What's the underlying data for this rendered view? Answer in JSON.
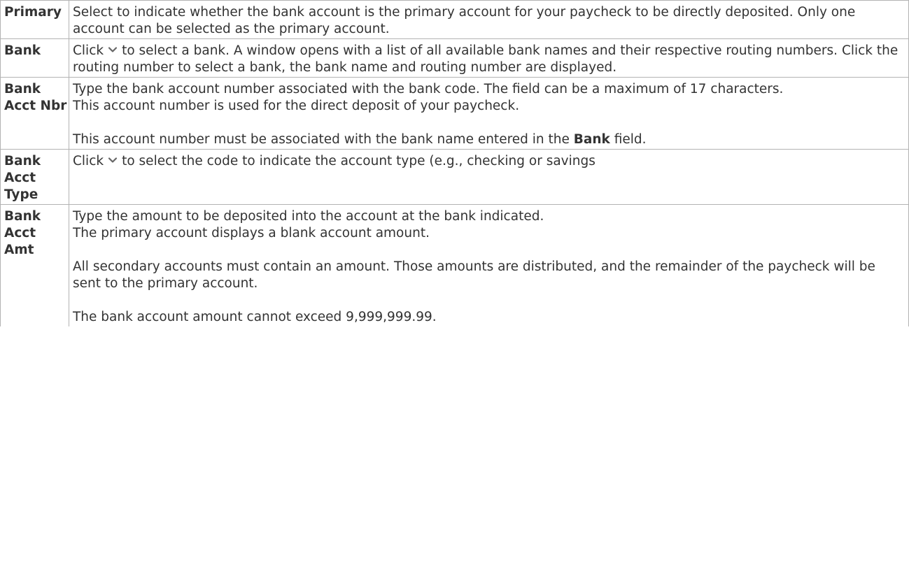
{
  "rows": [
    {
      "field": "Primary",
      "desc": [
        "Select to indicate whether the bank account is the primary account for your paycheck to be directly deposited. Only one account can be selected as the primary account."
      ]
    },
    {
      "field": "Bank",
      "desc_before_icon": "Click",
      "desc_after_icon": "to select a bank. A window opens with a list of all available bank names and their respective routing numbers. Click the routing number to select a bank, the bank name and routing number are displayed."
    },
    {
      "field": "Bank Acct Nbr",
      "desc": [
        "Type the bank account number associated with the bank code. The field can be a maximum of 17 characters.",
        "This account number is used for the direct deposit of your paycheck."
      ],
      "desc_gap_before": "This account number must be associated with the bank name entered in the",
      "desc_gap_bold": "Bank",
      "desc_gap_after": "field."
    },
    {
      "field": "Bank Acct Type",
      "desc_before_icon": "Click",
      "desc_after_icon": "to select the code to indicate the account type (e.g., checking or savings"
    },
    {
      "field": "Bank Acct Amt",
      "desc": [
        "Type the amount to be deposited into the account at the bank indicated.",
        "The primary account displays a blank account amount.",
        "All secondary accounts must contain an amount. Those amounts are distributed, and the remainder of the paycheck will be sent to the primary account.",
        "The bank account amount cannot exceed 9,999,999.99."
      ]
    }
  ],
  "icons": {
    "dropdown": "chevron-down-icon",
    "icon_color": "#666666"
  }
}
